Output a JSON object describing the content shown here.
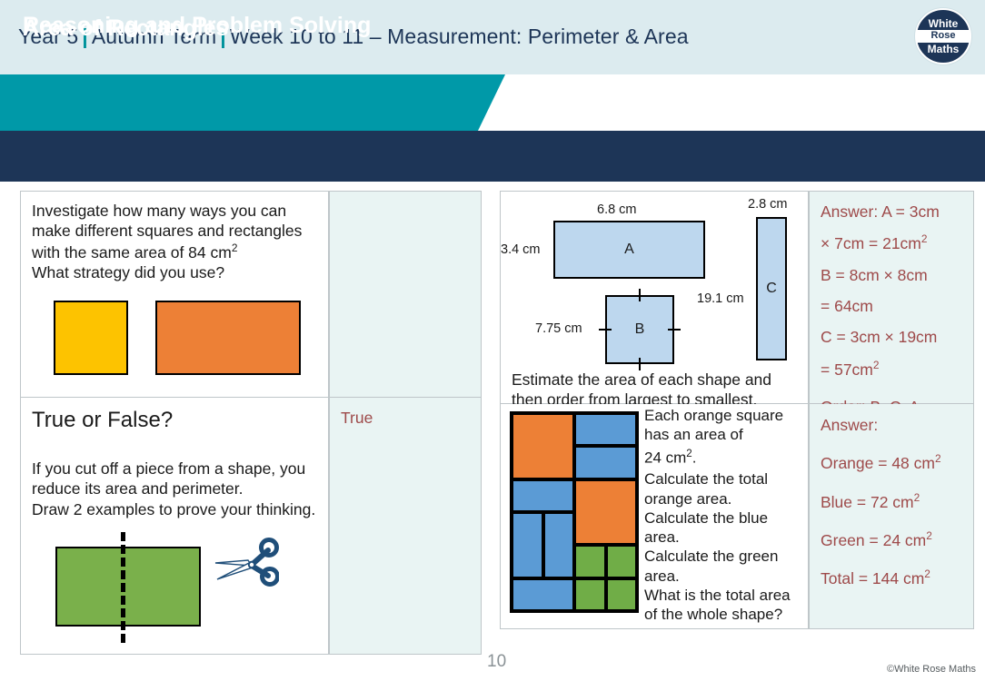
{
  "header": {
    "year": "Year 5",
    "term": "Autumn Term",
    "week": "Week 10 to 11 – Measurement: Perimeter & Area",
    "separator": "|",
    "logo": {
      "line1": "White",
      "line2": "Rose",
      "line3": "Maths"
    }
  },
  "banners": {
    "topic": "Area of Rectangles",
    "section": "Reasoning and Problem Solving"
  },
  "colors": {
    "navy": "#1d3557",
    "teal": "#0099a8",
    "top_band": "#dcebef",
    "answer_bg": "#e9f4f3",
    "answer_text": "#9e4a4a",
    "orange": "#ed8036",
    "yellow": "#fdc300",
    "green": "#70ad47",
    "green_rect": "#7ab04b",
    "blue": "#5b9bd5",
    "shape_fill": "#bdd7ee",
    "border": "#bfc6c9"
  },
  "questions": {
    "q1": {
      "line1": "Investigate how many ways you can",
      "line2": "make different squares and rectangles",
      "line3_pre": "with the same area of 84 cm",
      "line3_sup": "2",
      "line4": "What strategy did you use?",
      "shape_yellow": "yellow-square",
      "shape_orange": "orange-rectangle",
      "answer": ""
    },
    "q2": {
      "title": "True or False?",
      "line1": "If you cut off a piece from a shape, you",
      "line2": "reduce its area and perimeter.",
      "line3": "Draw 2 examples to prove your thinking.",
      "shape_green": "green-rectangle",
      "cut_line": "dashed-cut-line",
      "scissors": "scissors-icon",
      "answer": "True"
    },
    "q3": {
      "shapes": [
        {
          "label": "A",
          "width_label": "6.8 cm",
          "height_label": "3.4 cm"
        },
        {
          "label": "B",
          "side_label": "7.75 cm"
        },
        {
          "label": "C",
          "width_label": "2.8 cm",
          "height_label": "19.1 cm"
        }
      ],
      "prompt_line1": "Estimate the area of each shape and",
      "prompt_line2": "then order from largest to smallest.",
      "answer": {
        "l1": "Answer: A = 3cm",
        "l2_pre": "× 7cm = 21cm",
        "l2_sup": "2",
        "l3": "B = 8cm × 8cm",
        "l4": "= 64cm",
        "l5": "C = 3cm × 19cm",
        "l6_pre": "= 57cm",
        "l6_sup": "2",
        "l7": "Order: B, C, A"
      }
    },
    "q4": {
      "t1": "Each orange square",
      "t2": "has an area of",
      "t3_pre": "24 cm",
      "t3_sup": "2",
      "t3_post": ".",
      "t4": "Calculate the total",
      "t5": "orange area.",
      "t6": "Calculate the blue",
      "t7": "area.",
      "t8": "Calculate the green",
      "t9": "area.",
      "t10": "What is the total area",
      "t11": "of the whole shape?",
      "grid": {
        "columns": 4,
        "rows": 6,
        "cells": [
          {
            "color": "orange",
            "col": 1,
            "row": 1,
            "colspan": 2,
            "rowspan": 2
          },
          {
            "color": "blue",
            "col": 3,
            "row": 1,
            "colspan": 2,
            "rowspan": 1
          },
          {
            "color": "blue",
            "col": 3,
            "row": 2,
            "colspan": 2,
            "rowspan": 1
          },
          {
            "color": "blue",
            "col": 1,
            "row": 3,
            "colspan": 2,
            "rowspan": 1
          },
          {
            "color": "orange",
            "col": 3,
            "row": 3,
            "colspan": 2,
            "rowspan": 2
          },
          {
            "color": "blue",
            "col": 1,
            "row": 4,
            "colspan": 1,
            "rowspan": 2
          },
          {
            "color": "blue",
            "col": 2,
            "row": 4,
            "colspan": 1,
            "rowspan": 2
          },
          {
            "color": "green",
            "col": 3,
            "row": 5,
            "colspan": 1,
            "rowspan": 1
          },
          {
            "color": "green",
            "col": 4,
            "row": 5,
            "colspan": 1,
            "rowspan": 1
          },
          {
            "color": "blue",
            "col": 1,
            "row": 6,
            "colspan": 2,
            "rowspan": 1
          },
          {
            "color": "green",
            "col": 3,
            "row": 6,
            "colspan": 1,
            "rowspan": 1
          },
          {
            "color": "green",
            "col": 4,
            "row": 6,
            "colspan": 1,
            "rowspan": 1
          }
        ]
      },
      "answer": {
        "l1": "Answer:",
        "l2_pre": "Orange = 48 cm",
        "l2_sup": "2",
        "l3_pre": "Blue = 72 cm",
        "l3_sup": "2",
        "l4_pre": "Green = 24 cm",
        "l4_sup": "2",
        "l5_pre": "Total = 144 cm",
        "l5_sup": "2"
      }
    }
  },
  "footer": {
    "page_number": "10",
    "copyright": "©White Rose Maths"
  }
}
